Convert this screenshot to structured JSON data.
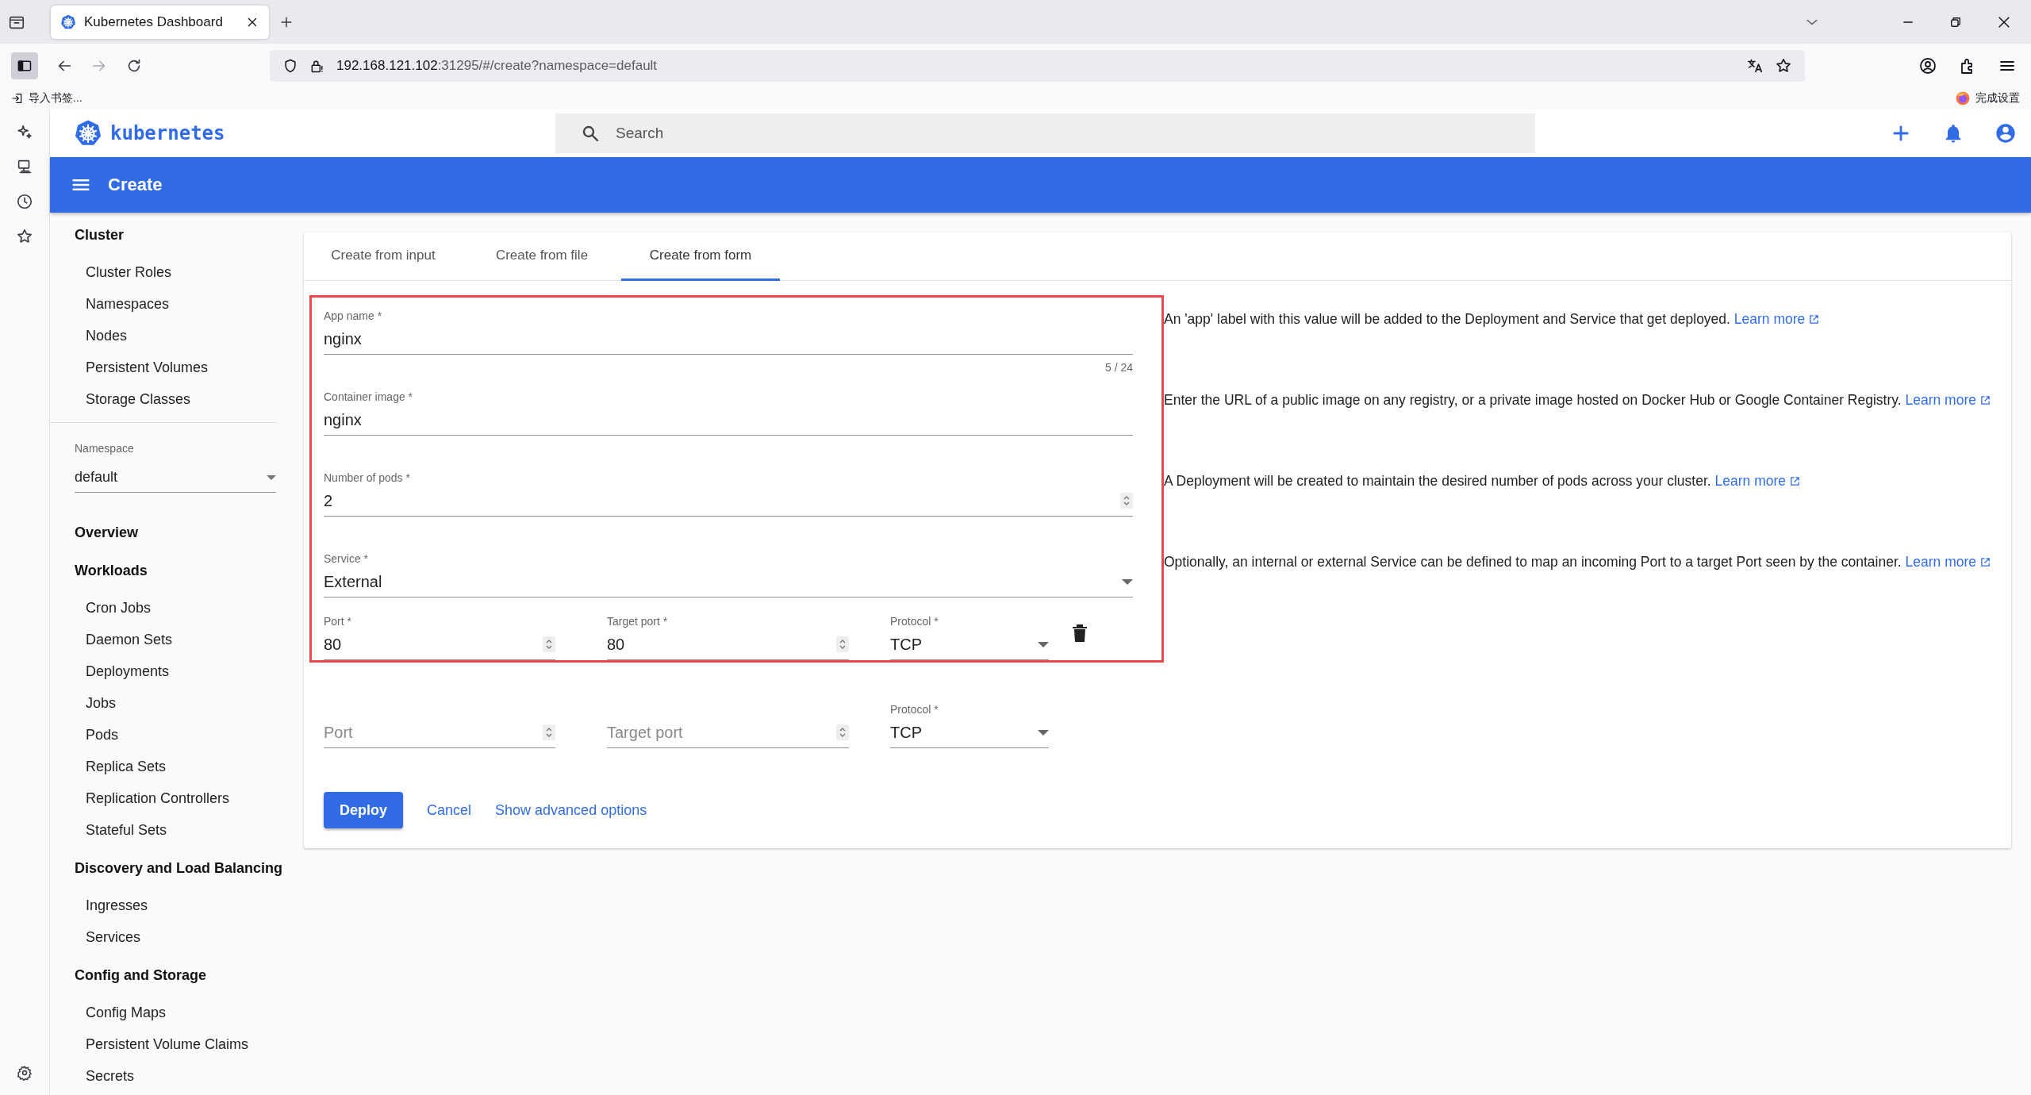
{
  "browser": {
    "tab_title": "Kubernetes Dashboard",
    "url_host": "192.168.121.102",
    "url_path": ":31295/#/create?namespace=default",
    "bookmark": "导入书签...",
    "setup": "完成设置"
  },
  "app": {
    "logo": "kubernetes",
    "search_placeholder": "Search",
    "page_title": "Create"
  },
  "sidebar": {
    "cluster": {
      "title": "Cluster",
      "items": [
        "Cluster Roles",
        "Namespaces",
        "Nodes",
        "Persistent Volumes",
        "Storage Classes"
      ]
    },
    "namespace": {
      "label": "Namespace",
      "value": "default"
    },
    "groups": [
      {
        "title": "Overview"
      },
      {
        "title": "Workloads",
        "items": [
          "Cron Jobs",
          "Daemon Sets",
          "Deployments",
          "Jobs",
          "Pods",
          "Replica Sets",
          "Replication Controllers",
          "Stateful Sets"
        ]
      },
      {
        "title": "Discovery and Load Balancing",
        "items": [
          "Ingresses",
          "Services"
        ]
      },
      {
        "title": "Config and Storage",
        "items": [
          "Config Maps",
          "Persistent Volume Claims",
          "Secrets"
        ]
      }
    ]
  },
  "tabs": [
    {
      "label": "Create from input",
      "selected": false
    },
    {
      "label": "Create from file",
      "selected": false
    },
    {
      "label": "Create from form",
      "selected": true
    }
  ],
  "fields": [
    {
      "kind": "text",
      "label": "App name *",
      "value": "nginx",
      "counter": "5 / 24",
      "help": "An 'app' label with this value will be added to the Deployment and Service that get deployed.",
      "link": "Learn more"
    },
    {
      "kind": "text",
      "label": "Container image *",
      "value": "nginx",
      "help": "Enter the URL of a public image on any registry, or a private image hosted on Docker Hub or Google Container Registry.",
      "link": "Learn more"
    },
    {
      "kind": "number",
      "label": "Number of pods *",
      "value": "2",
      "help": "A Deployment will be created to maintain the desired number of pods across your cluster.",
      "link": "Learn more"
    },
    {
      "kind": "select",
      "label": "Service *",
      "value": "External",
      "help": "Optionally, an internal or external Service can be defined to map an incoming Port to a target Port seen by the container.",
      "link": "Learn more"
    }
  ],
  "port_mappings": [
    {
      "port": {
        "label": "Port *",
        "value": "80"
      },
      "target_port": {
        "label": "Target port *",
        "value": "80"
      },
      "protocol": {
        "label": "Protocol *",
        "value": "TCP"
      },
      "removable": true
    },
    {
      "port": {
        "placeholder": "Port"
      },
      "target_port": {
        "placeholder": "Target port"
      },
      "protocol": {
        "label": "Protocol *",
        "value": "TCP"
      },
      "removable": false
    }
  ],
  "actions": {
    "deploy": "Deploy",
    "cancel": "Cancel",
    "advanced": "Show advanced options"
  }
}
